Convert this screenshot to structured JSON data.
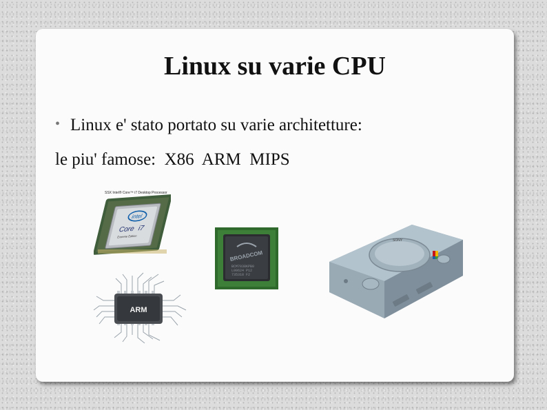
{
  "slide": {
    "title": "Linux su varie CPU",
    "bullet": "Linux e' stato portato su varie architetture:",
    "line2": "le piu' famose:  X86  ARM  MIPS"
  },
  "images": {
    "intel": {
      "header": "SSX Intel® Core™ i7 Desktop Processor",
      "brand": "intel",
      "model": "Core",
      "model_suffix": "i7",
      "sub": "Extreme Edition"
    },
    "arm": {
      "label": "ARM"
    },
    "broadcom": {
      "brand": "BROADCOM",
      "line1": "BCM7038KPB0",
      "line2": "L00624 P12",
      "line3": "735318 F2"
    },
    "playstation": {
      "brand": "SONY"
    }
  },
  "colors": {
    "slide_bg": "#fbfbfb",
    "page_bg": "#dcdcdc",
    "text": "#111111",
    "bullet": "#777777"
  }
}
